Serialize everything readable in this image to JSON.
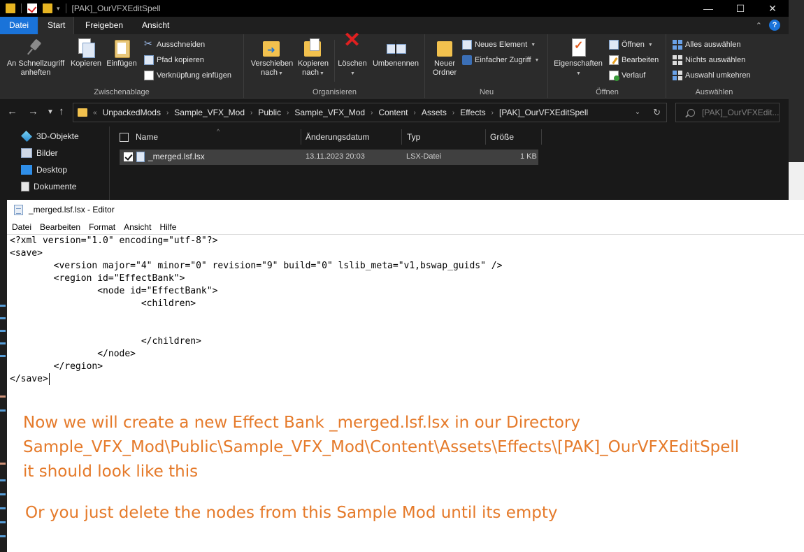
{
  "explorer": {
    "window_title": "[PAK]_OurVFXEditSpell",
    "menu_tabs": [
      "Datei",
      "Start",
      "Freigeben",
      "Ansicht"
    ],
    "help_icon": "?",
    "ribbon": {
      "clipboard": {
        "label": "Zwischenablage",
        "pin_label_1": "An Schnellzugriff",
        "pin_label_2": "anheften",
        "copy_label": "Kopieren",
        "paste_label": "Einfügen",
        "cut_label": "Ausschneiden",
        "copy_path_label": "Pfad kopieren",
        "paste_shortcut_label": "Verknüpfung einfügen"
      },
      "organize": {
        "label": "Organisieren",
        "move_label_1": "Verschieben",
        "move_label_2": "nach",
        "copyto_label_1": "Kopieren",
        "copyto_label_2": "nach",
        "delete_label": "Löschen",
        "rename_label": "Umbenennen"
      },
      "new": {
        "label": "Neu",
        "new_folder_label_1": "Neuer",
        "new_folder_label_2": "Ordner",
        "new_item_label": "Neues Element",
        "easy_access_label": "Einfacher Zugriff"
      },
      "open": {
        "label": "Öffnen",
        "properties_label": "Eigenschaften",
        "open_label": "Öffnen",
        "edit_label": "Bearbeiten",
        "history_label": "Verlauf"
      },
      "select": {
        "label": "Auswählen",
        "select_all_label": "Alles auswählen",
        "select_none_label": "Nichts auswählen",
        "invert_label": "Auswahl umkehren"
      }
    },
    "breadcrumbs": [
      "UnpackedMods",
      "Sample_VFX_Mod",
      "Public",
      "Sample_VFX_Mod",
      "Content",
      "Assets",
      "Effects",
      "[PAK]_OurVFXEditSpell"
    ],
    "search_placeholder": "[PAK]_OurVFXEdit...",
    "nav_items": [
      "3D-Objekte",
      "Bilder",
      "Desktop",
      "Dokumente"
    ],
    "columns": [
      "Name",
      "Änderungsdatum",
      "Typ",
      "Größe"
    ],
    "files": [
      {
        "name": "_merged.lsf.lsx",
        "modified": "13.11.2023 20:03",
        "type": "LSX-Datei",
        "size": "1 KB"
      }
    ]
  },
  "notepad": {
    "title": "_merged.lsf.lsx - Editor",
    "menu": [
      "Datei",
      "Bearbeiten",
      "Format",
      "Ansicht",
      "Hilfe"
    ],
    "lines": [
      "<?xml version=\"1.0\" encoding=\"utf-8\"?>",
      "<save>",
      "        <version major=\"4\" minor=\"0\" revision=\"9\" build=\"0\" lslib_meta=\"v1,bswap_guids\" />",
      "        <region id=\"EffectBank\">",
      "                <node id=\"EffectBank\">",
      "                        <children>",
      "",
      "",
      "                        </children>",
      "                </node>",
      "        </region>",
      "</save>"
    ]
  },
  "annotation": {
    "line1": "Now we will create a new Effect Bank  _merged.lsf.lsx in our Directory",
    "line2": "Sample_VFX_Mod\\Public\\Sample_VFX_Mod\\Content\\Assets\\Effects\\[PAK]_OurVFXEditSpell",
    "line3": "it should look like this",
    "line4": "Or you just delete the nodes from this Sample Mod until its empty",
    "color": "#e57a2a"
  },
  "colors": {
    "accent": "#1a73d9",
    "explorer_bg": "#191919",
    "ribbon_bg": "#2b2b2b"
  }
}
